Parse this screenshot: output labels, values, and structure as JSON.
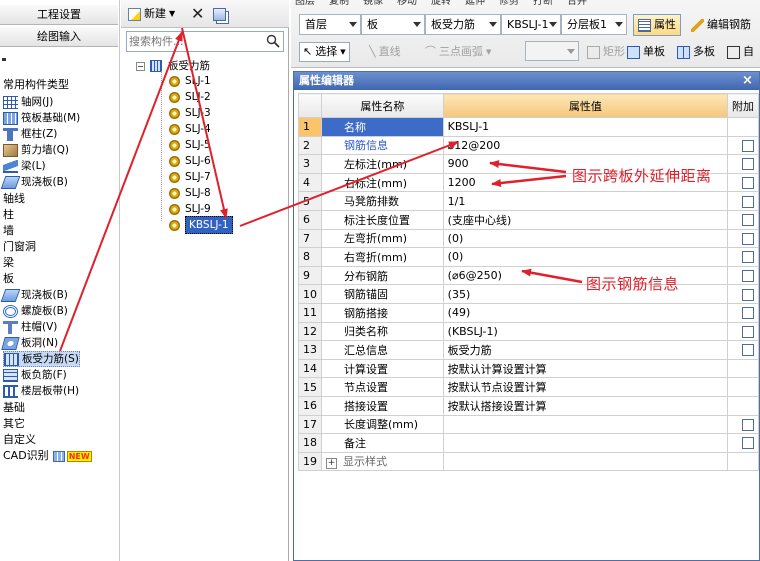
{
  "left_panel": {
    "header_buttons": [
      "工程设置",
      "绘图输入"
    ],
    "section_title": "常用构件类型",
    "common_items": [
      {
        "label": "轴网(J)",
        "icon": "grid-icon"
      },
      {
        "label": "筏板基础(M)",
        "icon": "raft-foundation-icon"
      },
      {
        "label": "框柱(Z)",
        "icon": "column-icon"
      },
      {
        "label": "剪力墙(Q)",
        "icon": "shear-wall-icon"
      },
      {
        "label": "梁(L)",
        "icon": "beam-icon"
      },
      {
        "label": "现浇板(B)",
        "icon": "slab-icon"
      }
    ],
    "categories_top": [
      "轴线",
      "柱",
      "墙",
      "门窗洞",
      "梁",
      "板"
    ],
    "slab_items": [
      {
        "label": "现浇板(B)",
        "icon": "slab-icon"
      },
      {
        "label": "螺旋板(B)",
        "icon": "spiral-slab-icon"
      },
      {
        "label": "柱帽(V)",
        "icon": "column-cap-icon"
      },
      {
        "label": "板洞(N)",
        "icon": "slab-hole-icon"
      },
      {
        "label": "板受力筋(S)",
        "icon": "slab-rebar-icon",
        "selected": true
      },
      {
        "label": "板负筋(F)",
        "icon": "negative-rebar-icon"
      },
      {
        "label": "楼层板带(H)",
        "icon": "slab-strip-icon"
      }
    ],
    "categories_bottom": [
      "基础",
      "其它",
      "自定义"
    ],
    "cad_label": "CAD识别",
    "new_badge": "NEW"
  },
  "middle_panel": {
    "new_button": "新建",
    "search_placeholder": "搜索构件...",
    "tree_root": "板受力筋",
    "tree_items": [
      "SLJ-1",
      "SLJ-2",
      "SLJ-3",
      "SLJ-4",
      "SLJ-5",
      "SLJ-6",
      "SLJ-7",
      "SLJ-8",
      "SLJ-9",
      "KBSLJ-1"
    ],
    "selected_item": "KBSLJ-1"
  },
  "toolbar": {
    "row0": [
      "图层",
      "复制",
      "镜像",
      "移动",
      "旋转",
      "延伸",
      "修剪",
      "打断",
      "合并"
    ],
    "floor": "首层",
    "category": "板",
    "component_type": "板受力筋",
    "component": "KBSLJ-1",
    "layer": "分层板1",
    "properties_button": "属性",
    "edit_rebar_button": "编辑钢筋",
    "select_button": "选择",
    "line_button": "直线",
    "arc_button": "三点画弧",
    "rect_button": "矩形",
    "single_slab_button": "单板",
    "multi_slab_button": "多板",
    "custom_button": "自"
  },
  "property_editor": {
    "title": "属性编辑器",
    "columns": [
      "属性名称",
      "属性值",
      "附加"
    ],
    "rows": [
      {
        "num": "1",
        "name": "名称",
        "value": "KBSLJ-1",
        "checkbox": false,
        "active": true
      },
      {
        "num": "2",
        "name": "钢筋信息",
        "value": "⌀12@200",
        "checkbox": true,
        "blue": true
      },
      {
        "num": "3",
        "name": "左标注(mm)",
        "value": "900",
        "checkbox": true
      },
      {
        "num": "4",
        "name": "右标注(mm)",
        "value": "1200",
        "checkbox": true
      },
      {
        "num": "5",
        "name": "马凳筋排数",
        "value": "1/1",
        "checkbox": true
      },
      {
        "num": "6",
        "name": "标注长度位置",
        "value": "(支座中心线)",
        "checkbox": true
      },
      {
        "num": "7",
        "name": "左弯折(mm)",
        "value": "(0)",
        "checkbox": true
      },
      {
        "num": "8",
        "name": "右弯折(mm)",
        "value": "(0)",
        "checkbox": true
      },
      {
        "num": "9",
        "name": "分布钢筋",
        "value": "(⌀6@250)",
        "checkbox": true
      },
      {
        "num": "10",
        "name": "钢筋锚固",
        "value": "(35)",
        "checkbox": true
      },
      {
        "num": "11",
        "name": "钢筋搭接",
        "value": "(49)",
        "checkbox": true
      },
      {
        "num": "12",
        "name": "归类名称",
        "value": "(KBSLJ-1)",
        "checkbox": true
      },
      {
        "num": "13",
        "name": "汇总信息",
        "value": "板受力筋",
        "checkbox": true
      },
      {
        "num": "14",
        "name": "计算设置",
        "value": "按默认计算设置计算",
        "checkbox": false
      },
      {
        "num": "15",
        "name": "节点设置",
        "value": "按默认节点设置计算",
        "checkbox": false
      },
      {
        "num": "16",
        "name": "搭接设置",
        "value": "按默认搭接设置计算",
        "checkbox": false
      },
      {
        "num": "17",
        "name": "长度调整(mm)",
        "value": "",
        "checkbox": true
      },
      {
        "num": "18",
        "name": "备注",
        "value": "",
        "checkbox": true
      },
      {
        "num": "19",
        "name": "显示样式",
        "value": "",
        "checkbox": false,
        "expandable": true
      }
    ]
  },
  "annotations": {
    "extension_note": "图示跨板外延伸距离",
    "distribution_note": "图示钢筋信息"
  },
  "colors": {
    "annotation_red": "#e0202a",
    "title_blue": "#4066b0",
    "selection_blue": "#3c6cc8",
    "header_orange": "#f4c77a"
  }
}
